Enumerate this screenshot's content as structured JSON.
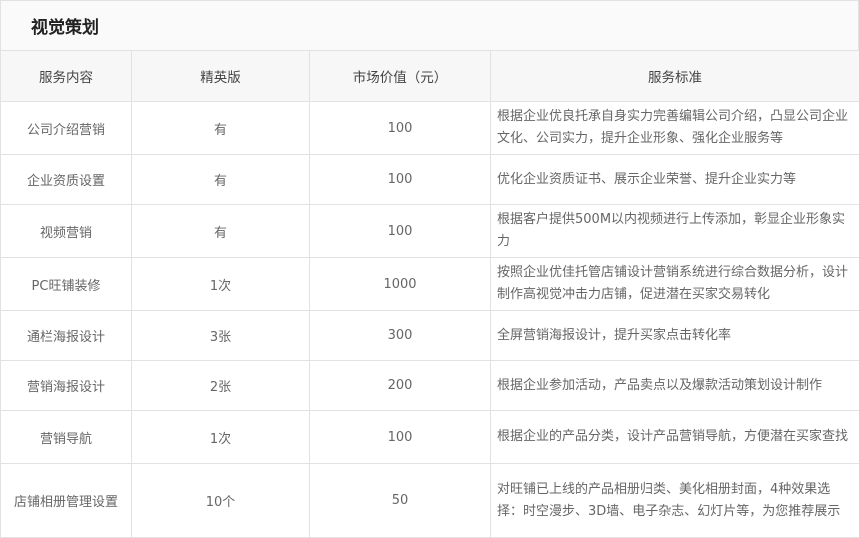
{
  "title": "视觉策划",
  "columns": [
    "服务内容",
    "精英版",
    "市场价值（元）",
    "服务标准"
  ],
  "rows": [
    {
      "service": "公司介绍营销",
      "elite": "有",
      "value": "100",
      "standard": "根据企业优良托承自身实力完善编辑公司介绍，凸显公司企业文化、公司实力，提升企业形象、强化企业服务等"
    },
    {
      "service": "企业资质设置",
      "elite": "有",
      "value": "100",
      "standard": "优化企业资质证书、展示企业荣誉、提升企业实力等"
    },
    {
      "service": "视频营销",
      "elite": "有",
      "value": "100",
      "standard": "根据客户提供500M以内视频进行上传添加，彰显企业形象实力"
    },
    {
      "service": "PC旺铺装修",
      "elite": "1次",
      "value": "1000",
      "standard": "按照企业优佳托管店铺设计营销系统进行综合数据分析，设计制作高视觉冲击力店铺，促进潜在买家交易转化"
    },
    {
      "service": "通栏海报设计",
      "elite": "3张",
      "value": "300",
      "standard": "全屏营销海报设计，提升买家点击转化率"
    },
    {
      "service": "营销海报设计",
      "elite": "2张",
      "value": "200",
      "standard": "根据企业参加活动，产品卖点以及爆款活动策划设计制作"
    },
    {
      "service": "营销导航",
      "elite": "1次",
      "value": "100",
      "standard": "根据企业的产品分类，设计产品营销导航，方便潜在买家查找"
    },
    {
      "service": "店铺相册管理设置",
      "elite": "10个",
      "value": "50",
      "standard": "对旺铺已上线的产品相册归类、美化相册封面，4种效果选择：时空漫步、3D墙、电子杂志、幻灯片等，为您推荐展示"
    }
  ]
}
